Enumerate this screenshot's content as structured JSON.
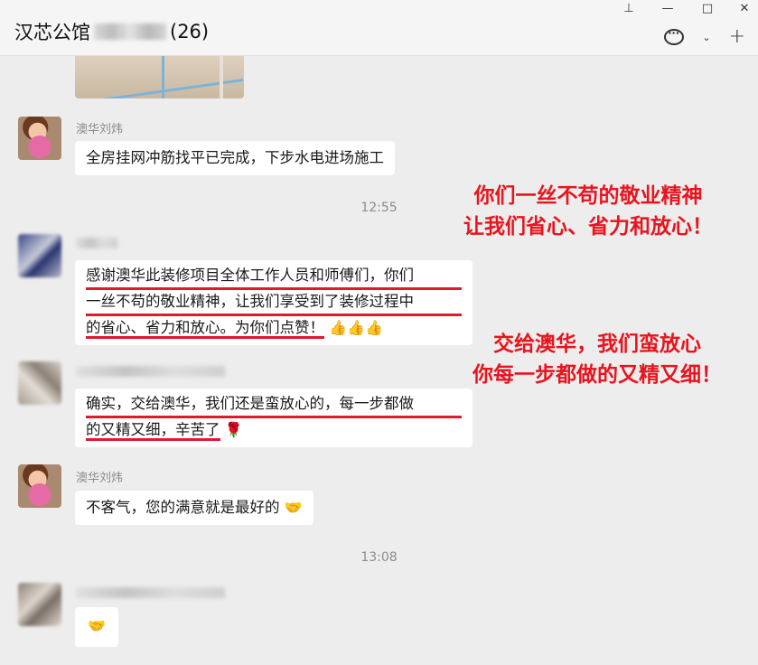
{
  "window": {
    "title_prefix": "汉芯公馆",
    "title_count": "(26)",
    "pin_icon": "pin-icon",
    "min_icon": "minimize-icon",
    "max_icon": "maximize-icon",
    "close_icon": "close-icon",
    "pin": "⊥",
    "minimize": "—",
    "maximize": "□",
    "close": "✕",
    "chevron": "⌄",
    "plus": "+"
  },
  "messages": [
    {
      "sender": "澳华刘炜",
      "text": "全房挂网冲筋找平已完成，下步水电进场施工"
    },
    {
      "time": "12:55"
    },
    {
      "lines": [
        "感谢澳华此装修项目全体工作人员和师傅们，你们",
        "一丝不苟的敬业精神，让我们享受到了装修过程中",
        "的省心、省力和放心。为你们点赞！"
      ],
      "emoji": "👍👍👍"
    },
    {
      "lines": [
        "确实，交给澳华，我们还是蛮放心的，每一步都做",
        "的又精又细，辛苦了"
      ],
      "emoji": "🌹"
    },
    {
      "sender": "澳华刘炜",
      "text": "不客气，您的满意就是最好的",
      "emoji": "🤝"
    },
    {
      "time": "13:08"
    },
    {
      "emoji": "🤝"
    }
  ],
  "annotations": [
    {
      "lines": [
        "你们一丝不苟的敬业精神",
        "让我们省心、省力和放心！"
      ]
    },
    {
      "lines": [
        "交给澳华，我们蛮放心",
        "你每一步都做的又精又细！"
      ]
    }
  ],
  "colors": {
    "accent_red": "#e8141e",
    "bubble": "#ffffff",
    "background": "#ededed"
  }
}
